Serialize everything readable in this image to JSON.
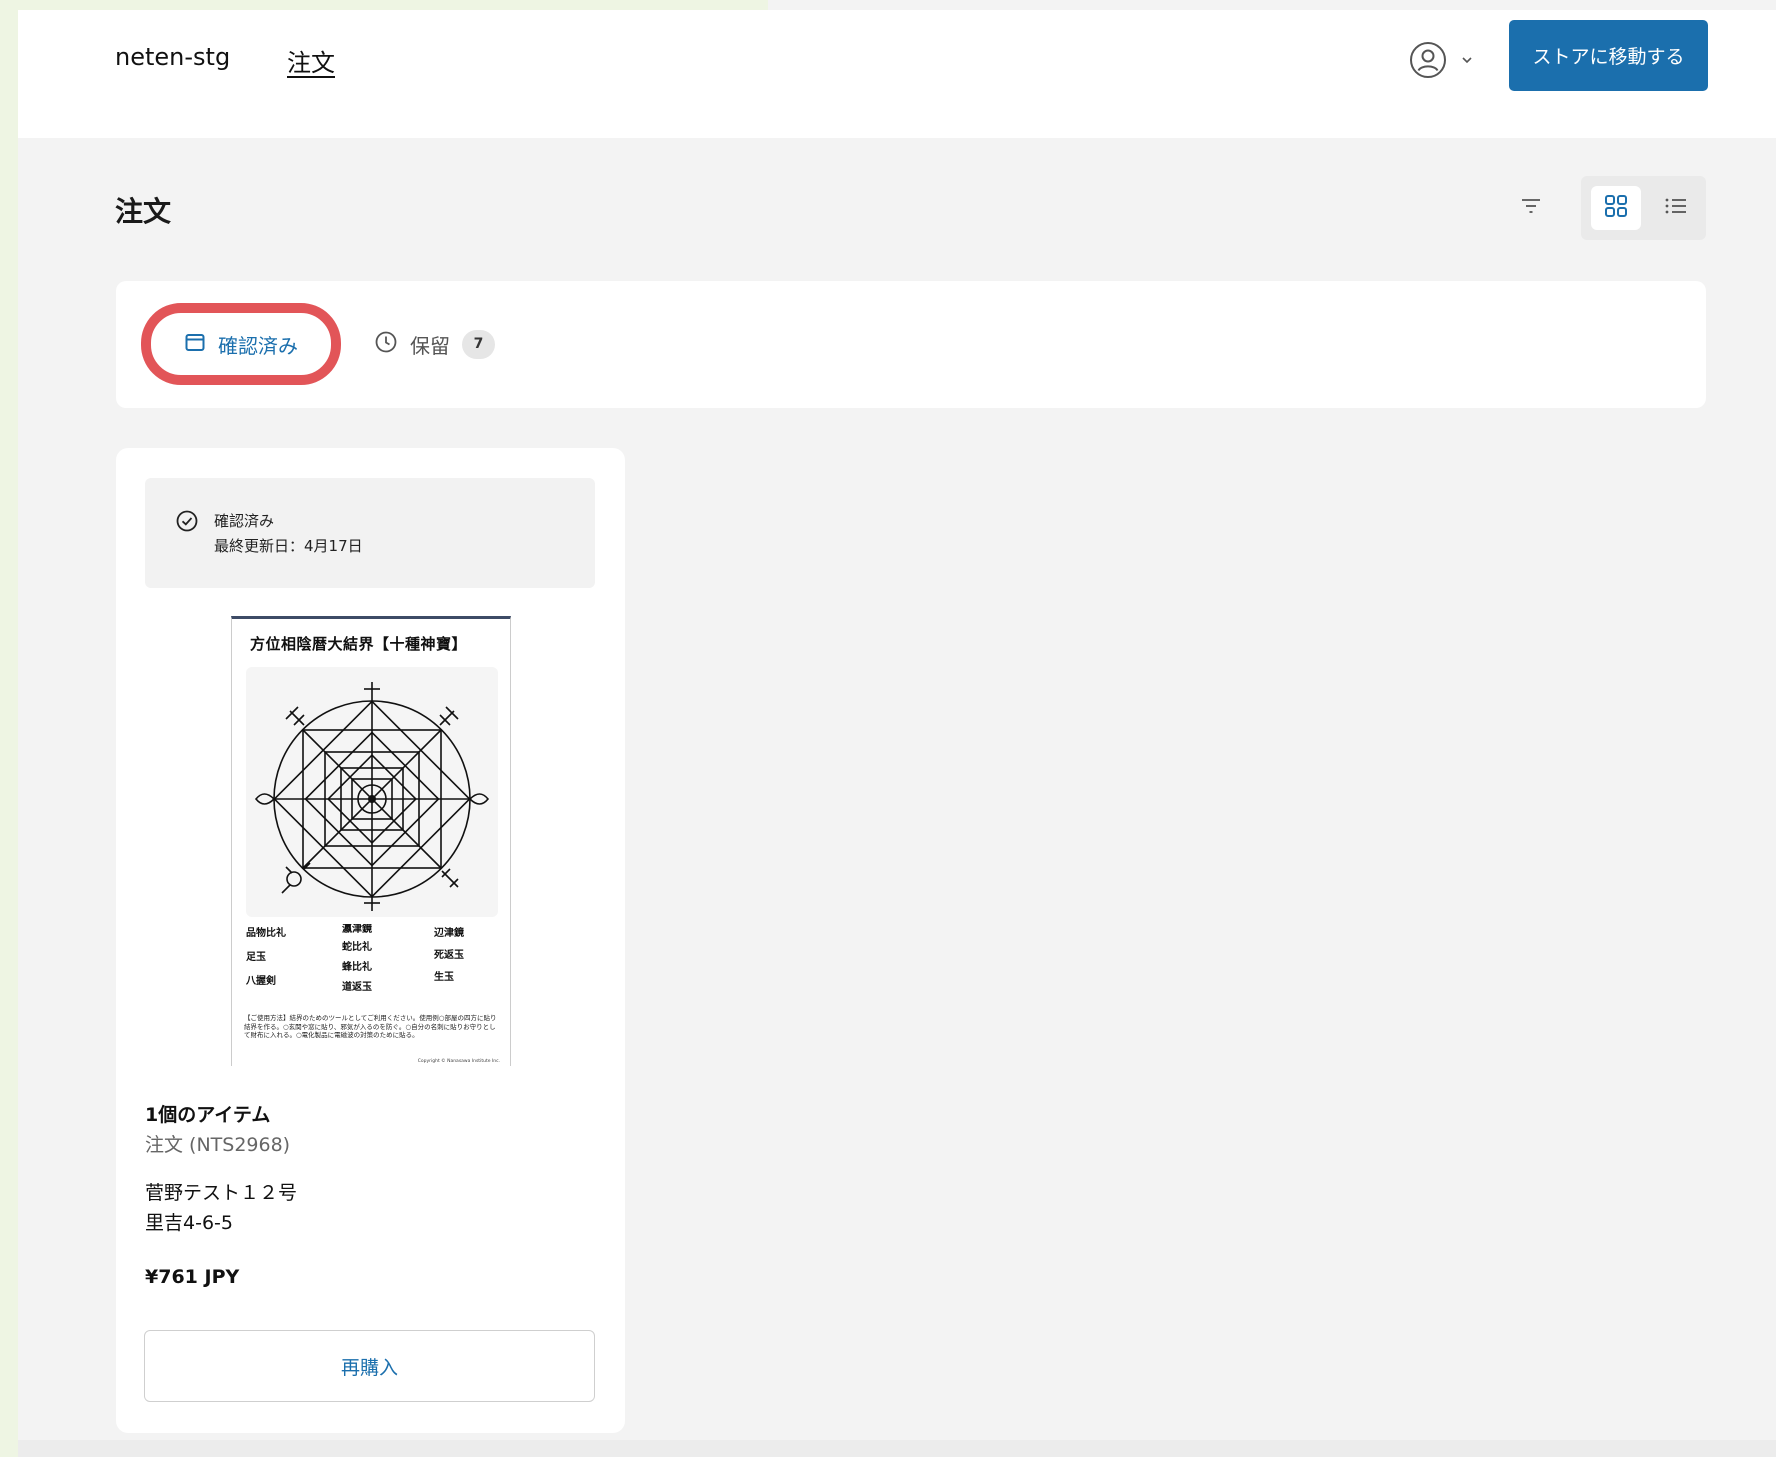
{
  "header": {
    "store_name": "neten-stg",
    "nav_orders": "注文",
    "store_button": "ストアに移動する"
  },
  "page": {
    "title": "注文"
  },
  "filters": {
    "confirmed_tab": "確認済み",
    "hold_tab": "保留",
    "hold_count": "7"
  },
  "order": {
    "status": "確認済み",
    "last_updated": "最終更新日：4月17日",
    "item_count": "1個のアイテム",
    "order_number": "注文 (NTS2968)",
    "address_name": "菅野テスト１２号",
    "address_line": "里吉4-6-5",
    "price": "¥761 JPY",
    "rebuy_button": "再購入"
  },
  "product_image": {
    "title": "方位相陰暦大結界【十種神寶】",
    "labels": [
      "品物比礼",
      "足玉",
      "八握剣",
      "死返玉",
      "蛇比礼",
      "蜂比礼",
      "道返玉",
      "辺津鏡",
      "生玉",
      "瀛津鏡"
    ],
    "fine_print": "【ご使用方法】結界のためのツールとしてご利用ください。使用例○部屋の四方に貼り結界を作る。○玄関や窓に貼り、邪気が入るのを防ぐ。○自分の名刺に貼りお守りとして財布に入れる。○電化製品に電磁波の対策のために貼る。",
    "copyright": "Copyright © Nanasawa Institute Inc."
  },
  "icons": {
    "account": "account-circle-icon",
    "filter": "filter-icon",
    "grid": "grid-view-icon",
    "list": "list-view-icon",
    "confirmed": "calendar-icon",
    "hold": "clock-icon",
    "status": "check-circle-icon"
  },
  "colors": {
    "primary": "#1b6fad",
    "highlight_ring": "#e25558",
    "page_bg": "#f3f3f3",
    "outer_bg": "#eef5e3"
  }
}
